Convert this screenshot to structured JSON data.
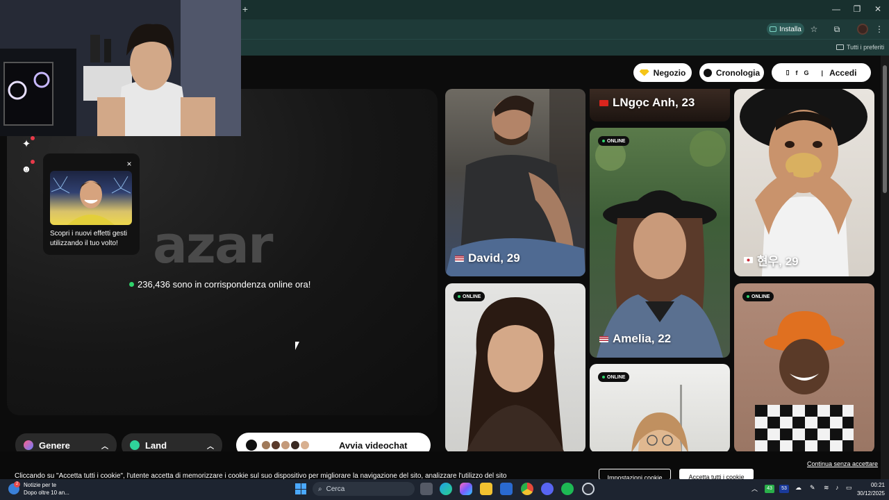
{
  "browser": {
    "new_tab": "+",
    "install_label": "Installa",
    "bookmarks_all": "Tutti i preferiti",
    "window": {
      "minimize": "—",
      "restore": "❐",
      "close": "✕"
    }
  },
  "header": {
    "shop_label": "Negozio",
    "history_label": "Cronologia",
    "login_label": "Accedi",
    "login_social": [
      "▯",
      "f",
      "G",
      "",
      "|"
    ]
  },
  "popup": {
    "close": "×",
    "text": "Scopri i nuovi effetti gesti utilizzando il tuo volto!"
  },
  "hero": {
    "logo": "azar",
    "online_text": "236,436 sono in corrispondenza online ora!"
  },
  "controls": {
    "gender_label": "Genere",
    "region_label": "Land",
    "start_label": "Avvia videochat"
  },
  "cards": [
    {
      "name": "David, 29",
      "flag": "us",
      "online": false
    },
    {
      "name": "LNgọc Anh, 23",
      "flag": "vn",
      "online": false
    },
    {
      "name": "현우, 29",
      "flag": "kr",
      "online": false
    },
    {
      "name": "Amelia, 22",
      "flag": "us",
      "online": true,
      "badge": "ONLINE"
    },
    {
      "name": "",
      "flag": "",
      "online": true,
      "badge": "ONLINE"
    },
    {
      "name": "",
      "flag": "",
      "online": true,
      "badge": "ONLINE"
    },
    {
      "name": "",
      "flag": "",
      "online": true,
      "badge": "ONLINE"
    }
  ],
  "cookie": {
    "text": "Cliccando su \"Accetta tutti i cookie\", l'utente accetta di memorizzare i cookie sul suo dispositivo per migliorare la navigazione del sito, analizzare l'utilizzo del sito",
    "continue": "Continua senza accettare",
    "settings": "Impostazioni cookie",
    "accept": "Accetta tutti i cookie"
  },
  "taskbar": {
    "news_title": "Notizie per te",
    "news_sub": "Dopo oltre 10 an...",
    "news_badge": "2",
    "search_placeholder": "Cerca",
    "tray_badge_1": "43",
    "tray_badge_2": "53",
    "time": "00:21",
    "date": "30/12/2025"
  },
  "colors": {
    "accent_online": "#2fd36b",
    "browser_bg": "#1e3a38"
  }
}
